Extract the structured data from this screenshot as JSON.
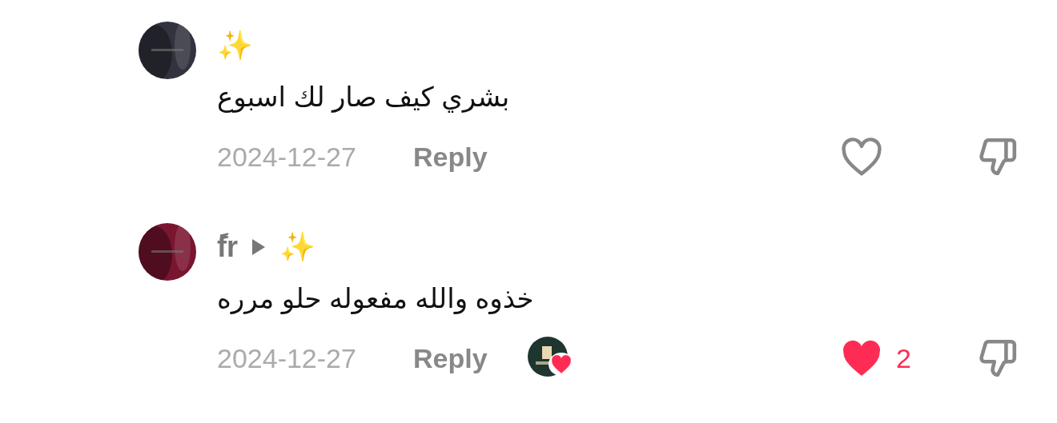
{
  "comments": [
    {
      "username": "✨",
      "text": "بشري كيف صار لك اسبوع",
      "date": "2024-12-27",
      "reply_label": "Reply",
      "creator_liked": false,
      "liked": false
    },
    {
      "username": "ًfr",
      "reply_to": "✨",
      "text": "خذوه والله مفعوله حلو مرره",
      "date": "2024-12-27",
      "reply_label": "Reply",
      "creator_liked": true,
      "liked": true,
      "like_count": "2"
    }
  ]
}
